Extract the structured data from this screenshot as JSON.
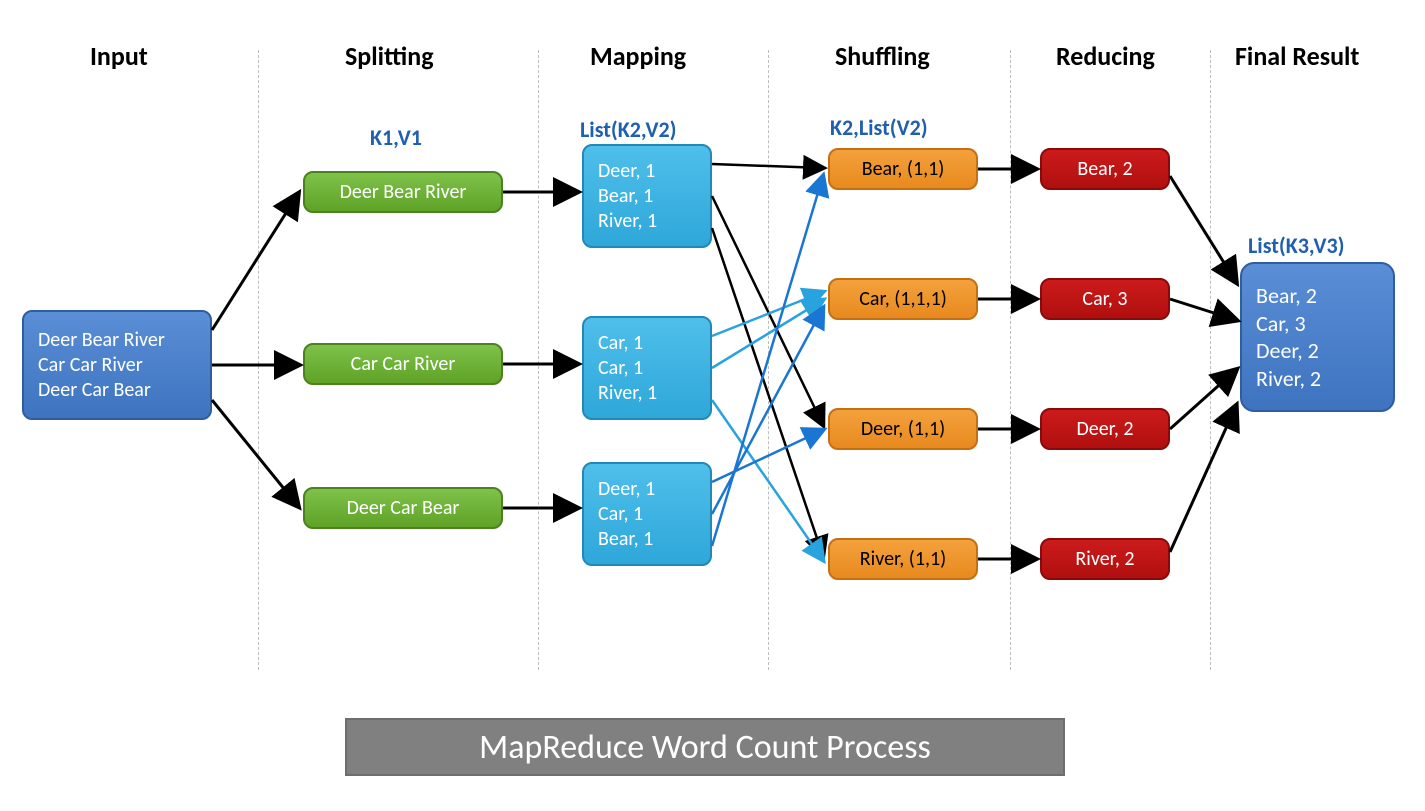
{
  "stages": {
    "input": "Input",
    "splitting": "Splitting",
    "mapping": "Mapping",
    "shuffling": "Shuffling",
    "reducing": "Reducing",
    "final": "Final Result"
  },
  "sublabels": {
    "k1v1": "K1,V1",
    "listk2v2": "List(K2,V2)",
    "k2listv2": "K2,List(V2)",
    "listk3v3": "List(K3,V3)"
  },
  "input": {
    "lines": [
      "Deer Bear River",
      "Car Car River",
      "Deer Car Bear"
    ]
  },
  "splits": [
    "Deer Bear River",
    "Car Car River",
    "Deer Car Bear"
  ],
  "maps": [
    [
      "Deer, 1",
      "Bear, 1",
      "River, 1"
    ],
    [
      "Car, 1",
      "Car, 1",
      "River, 1"
    ],
    [
      "Deer, 1",
      "Car, 1",
      "Bear, 1"
    ]
  ],
  "shuffles": [
    "Bear, (1,1)",
    "Car, (1,1,1)",
    "Deer, (1,1)",
    "River, (1,1)"
  ],
  "reduces": [
    "Bear, 2",
    "Car, 3",
    "Deer, 2",
    "River, 2"
  ],
  "final": {
    "lines": [
      "Bear, 2",
      "Car, 3",
      "Deer, 2",
      "River, 2"
    ]
  },
  "title": "MapReduce Word Count Process"
}
